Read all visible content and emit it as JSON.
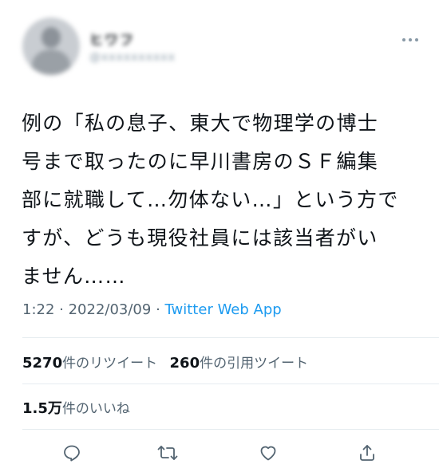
{
  "user": {
    "display_name": "ヒワフ",
    "handle": "@xxxxxxxxxx"
  },
  "tweet": {
    "text_lines": [
      "例の「私の息子、東大で物理学の博士",
      "号まで取ったのに早川書房のＳＦ編集",
      "部に就職して…勿体ない…」という方で",
      "すが、どうも現役社員には該当者がい",
      "ません……"
    ],
    "time": "1:22",
    "separator": " · ",
    "date": "2022/03/09",
    "source": "Twitter Web App"
  },
  "stats": {
    "retweets_count": "5270",
    "retweets_label": "件のリツイート",
    "quotes_count": "260",
    "quotes_label": "件の引用ツイート",
    "likes_count": "1.5万",
    "likes_label": "件のいいね"
  },
  "icons": {
    "more": "more-horizontal-icon",
    "reply": "reply-icon",
    "retweet": "retweet-icon",
    "like": "like-icon",
    "share": "share-icon"
  },
  "colors": {
    "text": "#0f1419",
    "secondary": "#536471",
    "link": "#1d9bf0",
    "divider": "#e6ecf0"
  }
}
